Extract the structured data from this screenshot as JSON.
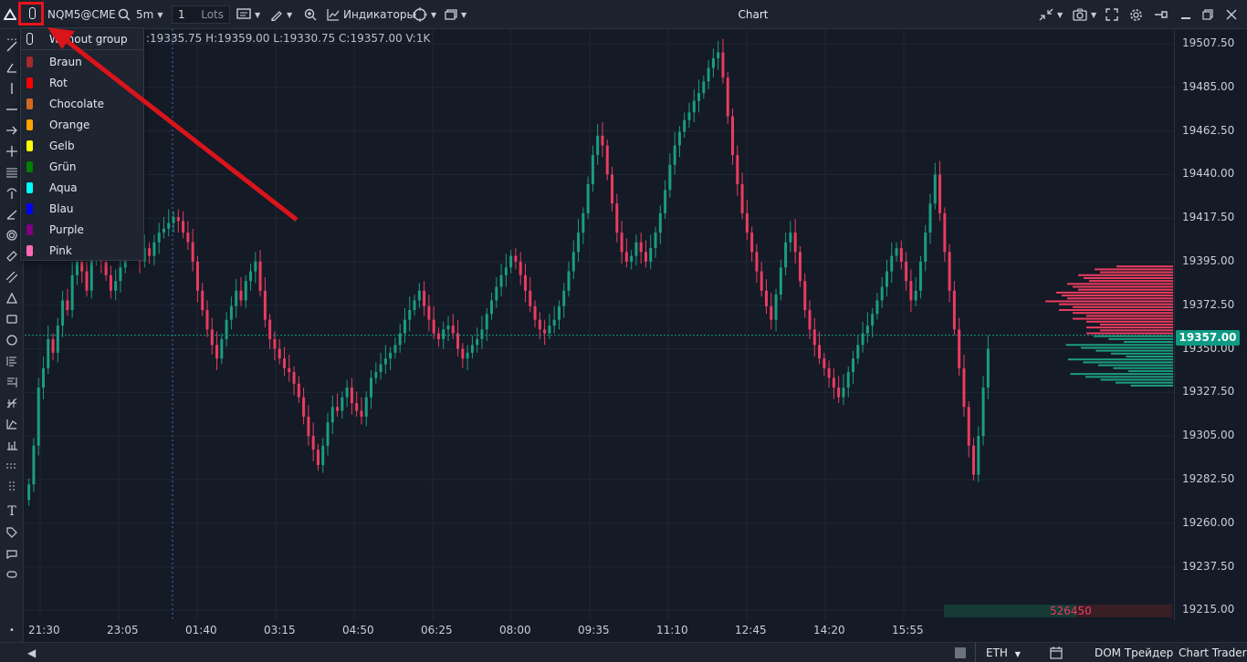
{
  "toolbar": {
    "symbol": "NQM5@CME",
    "timeframe": "5m",
    "quantity": "1",
    "quantity_unit": "Lots",
    "indicators_label": "Индикаторы",
    "title": "Chart"
  },
  "ohlc_text": ":19335.75 H:19359.00 L:19330.75 C:19357.00 V:1K",
  "group_menu": {
    "items": [
      {
        "label": "Without group",
        "color": ""
      },
      {
        "label": "Braun",
        "color": "#a52a2a"
      },
      {
        "label": "Rot",
        "color": "#ff0000"
      },
      {
        "label": "Chocolate",
        "color": "#d2691e"
      },
      {
        "label": "Orange",
        "color": "#ffa500"
      },
      {
        "label": "Gelb",
        "color": "#ffff00"
      },
      {
        "label": "Grün",
        "color": "#008000"
      },
      {
        "label": "Aqua",
        "color": "#00ffff"
      },
      {
        "label": "Blau",
        "color": "#0000ff"
      },
      {
        "label": "Purple",
        "color": "#800080"
      },
      {
        "label": "Pink",
        "color": "#ff69b4"
      }
    ]
  },
  "price_axis": [
    "19507.50",
    "19485.00",
    "19462.50",
    "19440.00",
    "19417.50",
    "19395.00",
    "19372.50",
    "19350.00",
    "19327.50",
    "19305.00",
    "19282.50",
    "19260.00",
    "19237.50",
    "19215.00"
  ],
  "last_price": "19357.00",
  "time_axis": [
    "21:30",
    "23:05",
    "01:40",
    "03:15",
    "04:50",
    "06:25",
    "08:00",
    "09:35",
    "11:10",
    "12:45",
    "14:20",
    "15:55"
  ],
  "volume_summary": {
    "value": "526450"
  },
  "bottom_bar": {
    "session": "ETH",
    "dom_trader": "DOM Трейдер",
    "chart_trader": "Chart Trader"
  },
  "colors": {
    "up": "#1c9c80",
    "down": "#ea3c5f",
    "background": "#141a26",
    "accent": "#0e9a84",
    "highlight": "#e8141b"
  },
  "chart_data": {
    "type": "candlestick",
    "symbol": "NQM5@CME",
    "timeframe": "5m",
    "yticks": [
      19507.5,
      19485.0,
      19462.5,
      19440.0,
      19417.5,
      19395.0,
      19372.5,
      19350.0,
      19327.5,
      19305.0,
      19282.5,
      19260.0,
      19237.5,
      19215.0
    ],
    "ylim": [
      19210,
      19515
    ],
    "last_price": 19357.0,
    "closes": [
      19280,
      19300,
      19330,
      19340,
      19355,
      19348,
      19362,
      19375,
      19370,
      19388,
      19395,
      19390,
      19380,
      19398,
      19402,
      19395,
      19388,
      19380,
      19385,
      19392,
      19400,
      19410,
      19405,
      19395,
      19402,
      19398,
      19405,
      19410,
      19412,
      19415,
      19418,
      19416,
      19410,
      19405,
      19395,
      19380,
      19370,
      19360,
      19352,
      19345,
      19355,
      19365,
      19372,
      19380,
      19375,
      19385,
      19390,
      19395,
      19380,
      19365,
      19355,
      19350,
      19345,
      19340,
      19338,
      19332,
      19325,
      19315,
      19305,
      19298,
      19290,
      19300,
      19312,
      19320,
      19318,
      19325,
      19330,
      19322,
      19318,
      19315,
      19325,
      19335,
      19338,
      19342,
      19345,
      19348,
      19352,
      19358,
      19365,
      19370,
      19375,
      19380,
      19372,
      19365,
      19358,
      19355,
      19360,
      19362,
      19358,
      19350,
      19345,
      19348,
      19352,
      19355,
      19360,
      19368,
      19375,
      19382,
      19388,
      19392,
      19398,
      19395,
      19388,
      19380,
      19372,
      19365,
      19360,
      19358,
      19362,
      19365,
      19372,
      19380,
      19390,
      19400,
      19410,
      19420,
      19435,
      19450,
      19460,
      19455,
      19440,
      19425,
      19410,
      19400,
      19395,
      19398,
      19405,
      19400,
      19395,
      19402,
      19410,
      19420,
      19432,
      19445,
      19455,
      19462,
      19468,
      19472,
      19478,
      19482,
      19488,
      19495,
      19500,
      19503,
      19490,
      19470,
      19450,
      19435,
      19420,
      19410,
      19400,
      19390,
      19380,
      19372,
      19365,
      19378,
      19392,
      19405,
      19410,
      19400,
      19385,
      19370,
      19360,
      19352,
      19345,
      19340,
      19335,
      19330,
      19325,
      19330,
      19338,
      19345,
      19352,
      19358,
      19362,
      19368,
      19375,
      19382,
      19390,
      19398,
      19402,
      19395,
      19385,
      19375,
      19380,
      19395,
      19410,
      19425,
      19440,
      19420,
      19400,
      19380,
      19360,
      19340,
      19320,
      19300,
      19285,
      19305,
      19330,
      19350
    ],
    "volume_profile_note": "right-side profile shading red above last price, green below"
  }
}
